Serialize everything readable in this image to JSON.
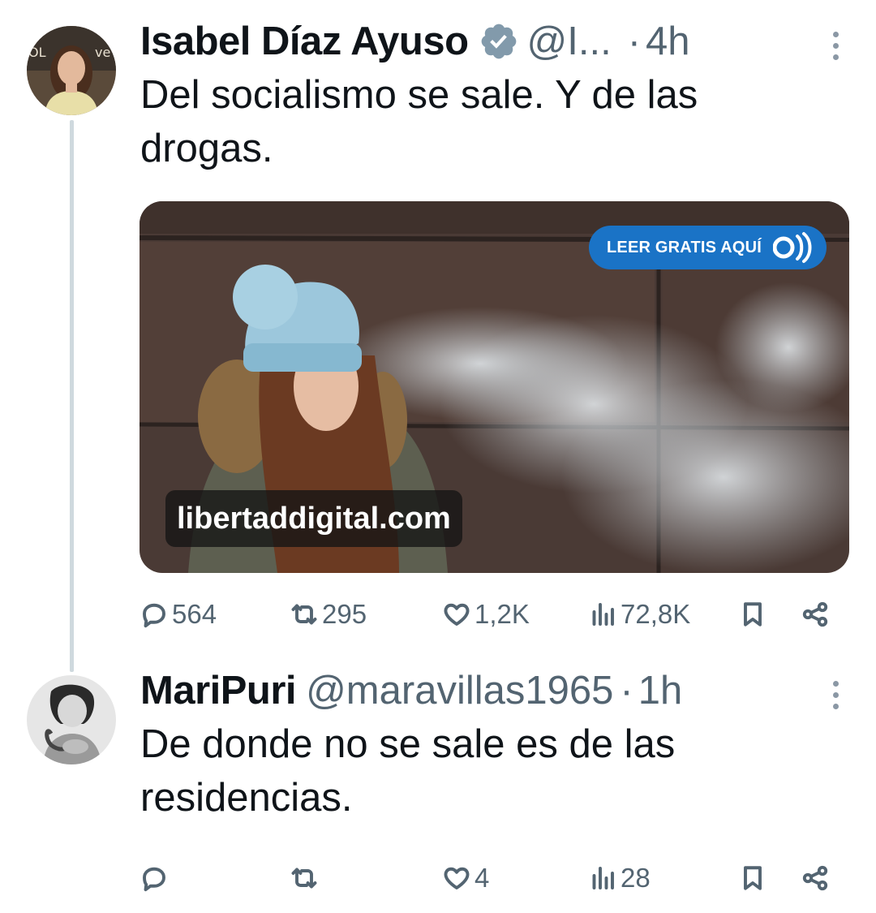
{
  "tweets": [
    {
      "author": "Isabel Díaz Ayuso",
      "handle": "@I...",
      "separator": "·",
      "time": "4h",
      "text": "Del socialismo se sale. Y de las drogas.",
      "verified": true,
      "media": {
        "cta": "LEER GRATIS AQUÍ",
        "domain": "libertaddigital.com"
      },
      "stats": {
        "replies": "564",
        "retweets": "295",
        "likes": "1,2K",
        "views": "72,8K"
      }
    },
    {
      "author": "MariPuri",
      "handle": "@maravillas1965",
      "separator": "·",
      "time": "1h",
      "text": "De donde no se sale es de las residencias.",
      "verified": false,
      "stats": {
        "replies": "",
        "retweets": "",
        "likes": "4",
        "views": "28"
      }
    }
  ],
  "icons": {
    "reply": "reply-icon",
    "retweet": "retweet-icon",
    "like": "like-icon",
    "views": "views-icon",
    "bookmark": "bookmark-icon",
    "share": "share-icon",
    "verified": "verified-badge-icon",
    "more": "more-options-icon"
  },
  "colors": {
    "text": "#0f1419",
    "secondary": "#536471",
    "verified": "#829aab",
    "thread_line": "#cfd9de",
    "cta_blue": "#1a73c6"
  }
}
